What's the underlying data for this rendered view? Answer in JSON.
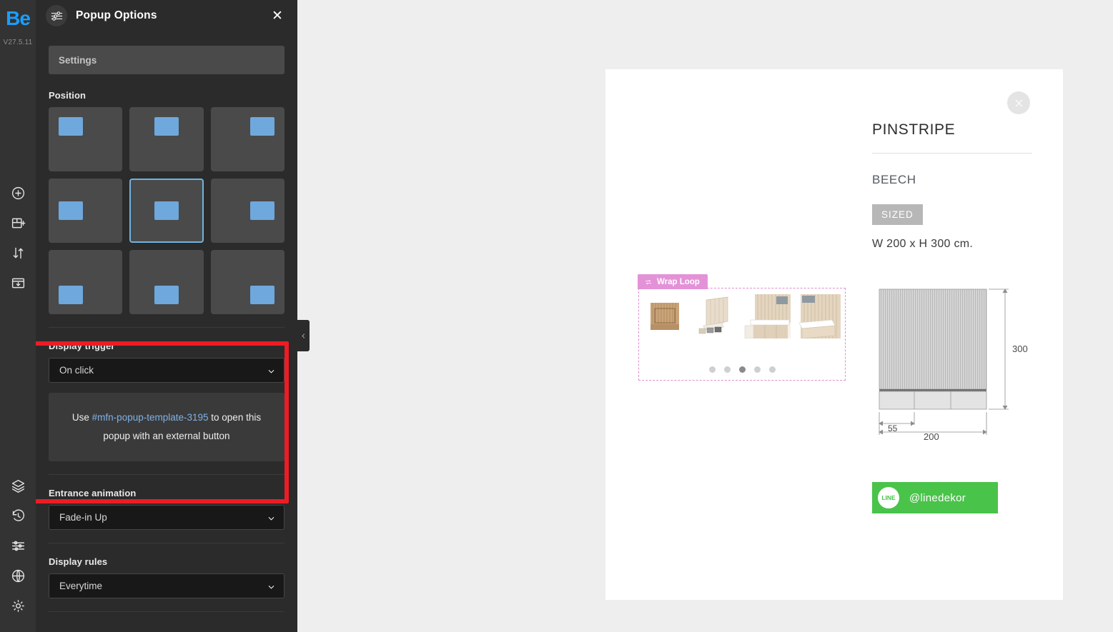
{
  "rail": {
    "logo": "Be",
    "version": "V27.5.11",
    "top_items": [
      {
        "name": "add-element-icon",
        "label": "Add element"
      },
      {
        "name": "add-section-icon",
        "label": "Add section"
      },
      {
        "name": "reorder-icon",
        "label": "Reorder"
      },
      {
        "name": "save-template-icon",
        "label": "Save template"
      }
    ],
    "bottom_items": [
      {
        "name": "layers-icon",
        "label": "Layers"
      },
      {
        "name": "history-icon",
        "label": "History"
      },
      {
        "name": "adjustments-icon",
        "label": "Adjustments"
      },
      {
        "name": "globe-icon",
        "label": "Global"
      },
      {
        "name": "settings-gear-icon",
        "label": "Settings"
      }
    ]
  },
  "panel": {
    "title": "Popup Options",
    "header_icon": "sliders-icon",
    "close_label": "✕",
    "tabs": [
      {
        "label": "Settings",
        "active": true
      }
    ],
    "position": {
      "label": "Position",
      "options": [
        {
          "key": "top-left",
          "class": "pc-tl",
          "selected": false
        },
        {
          "key": "top-center",
          "class": "pc-tc",
          "selected": false
        },
        {
          "key": "top-right",
          "class": "pc-tr",
          "selected": false
        },
        {
          "key": "middle-left",
          "class": "pc-ml",
          "selected": false
        },
        {
          "key": "middle-center",
          "class": "pc-mc",
          "selected": true
        },
        {
          "key": "middle-right",
          "class": "pc-mr",
          "selected": false
        },
        {
          "key": "bottom-left",
          "class": "pc-bl",
          "selected": false
        },
        {
          "key": "bottom-center",
          "class": "pc-bc",
          "selected": false
        },
        {
          "key": "bottom-right",
          "class": "pc-br",
          "selected": false
        }
      ]
    },
    "display_trigger": {
      "label": "Display trigger",
      "value": "On click",
      "hint_prefix": "Use ",
      "hint_code": "#mfn-popup-template-3195",
      "hint_suffix": " to open this popup with an external button"
    },
    "entrance_animation": {
      "label": "Entrance animation",
      "value": "Fade-in Up"
    },
    "display_rules": {
      "label": "Display rules",
      "value": "Everytime"
    },
    "collapse_icon": "chevron-left-icon",
    "highlight_color": "#ed1c24"
  },
  "card": {
    "close_icon": "close-icon",
    "product": {
      "title": "PINSTRIPE",
      "material": "BEECH",
      "badge": "SIZED",
      "dimensions": "W 200 x H 300 cm."
    },
    "drawing": {
      "height_label": "300",
      "width_label": "200",
      "segment_label": "55"
    },
    "line_button": {
      "icon_label": "LINE",
      "handle": "@linedekor",
      "color": "#4ac34a"
    },
    "gallery": {
      "badge": "Wrap Loop",
      "badge_icon": "loop-icon",
      "badge_color": "#e492d8",
      "thumbnail_count": 4,
      "dot_count": 5,
      "active_dot": 3
    }
  }
}
